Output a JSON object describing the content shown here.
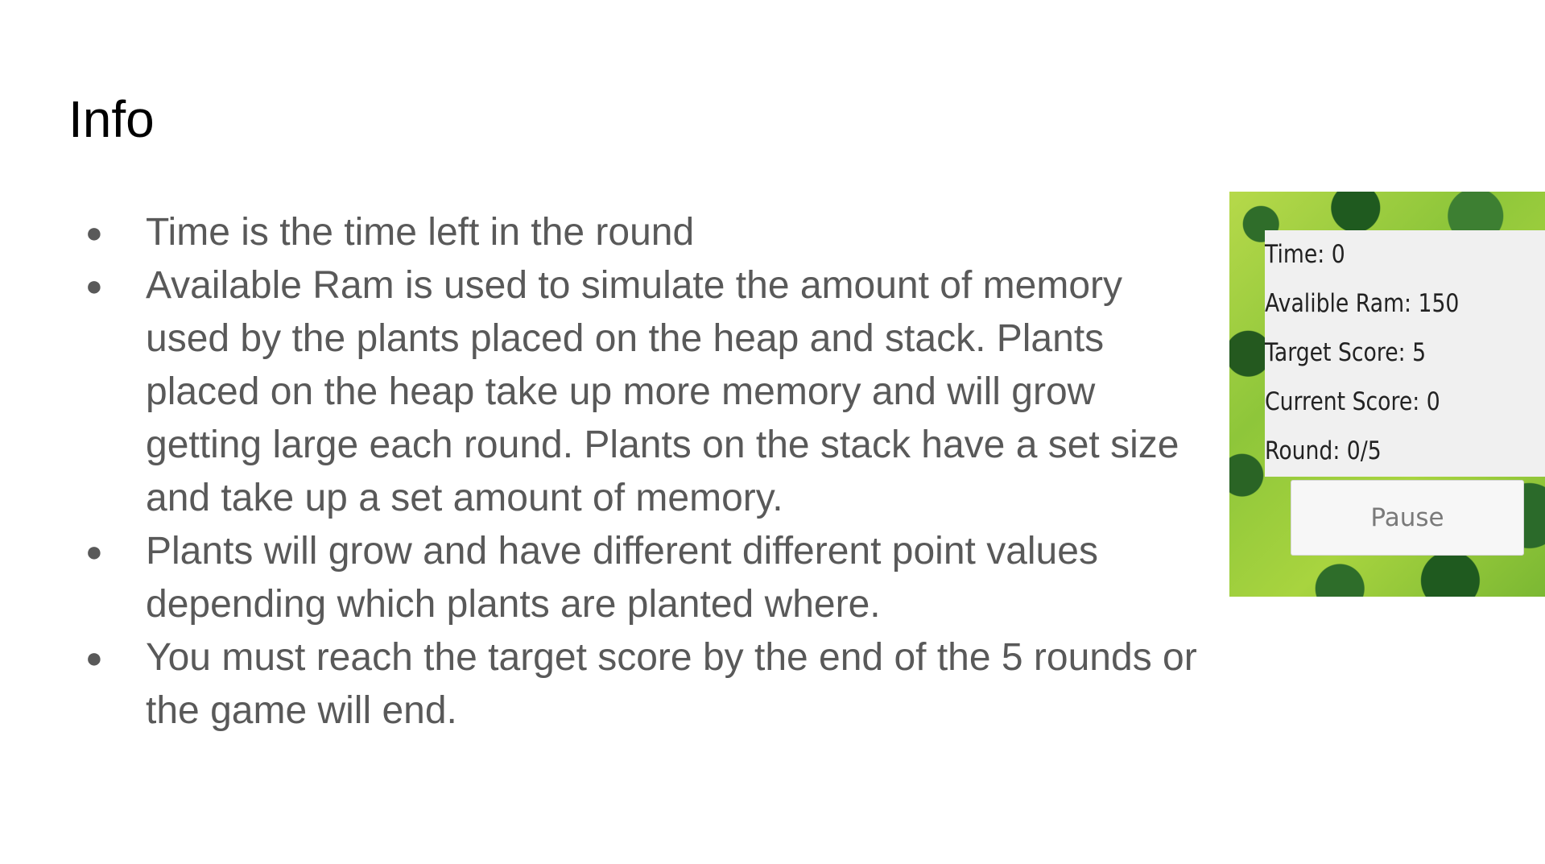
{
  "slide": {
    "title": "Info",
    "bullets": [
      "Time is the time left in the round",
      "Available Ram is used to simulate the amount of memory used by the plants placed on the heap and stack. Plants placed on the heap take up more memory and will grow getting large each round. Plants on the stack have a set size and take up a set amount of memory.",
      "Plants will grow and have different different point values depending which plants are planted where.",
      "You must reach the target score by the end of the 5 rounds or the game will end."
    ],
    "bullet_glyph": "●"
  },
  "game": {
    "stats": [
      "Time: 0",
      "Avalible Ram: 150",
      "Target Score: 5",
      "Current Score: 0",
      "Round: 0/5"
    ],
    "pause_label": "Pause"
  }
}
